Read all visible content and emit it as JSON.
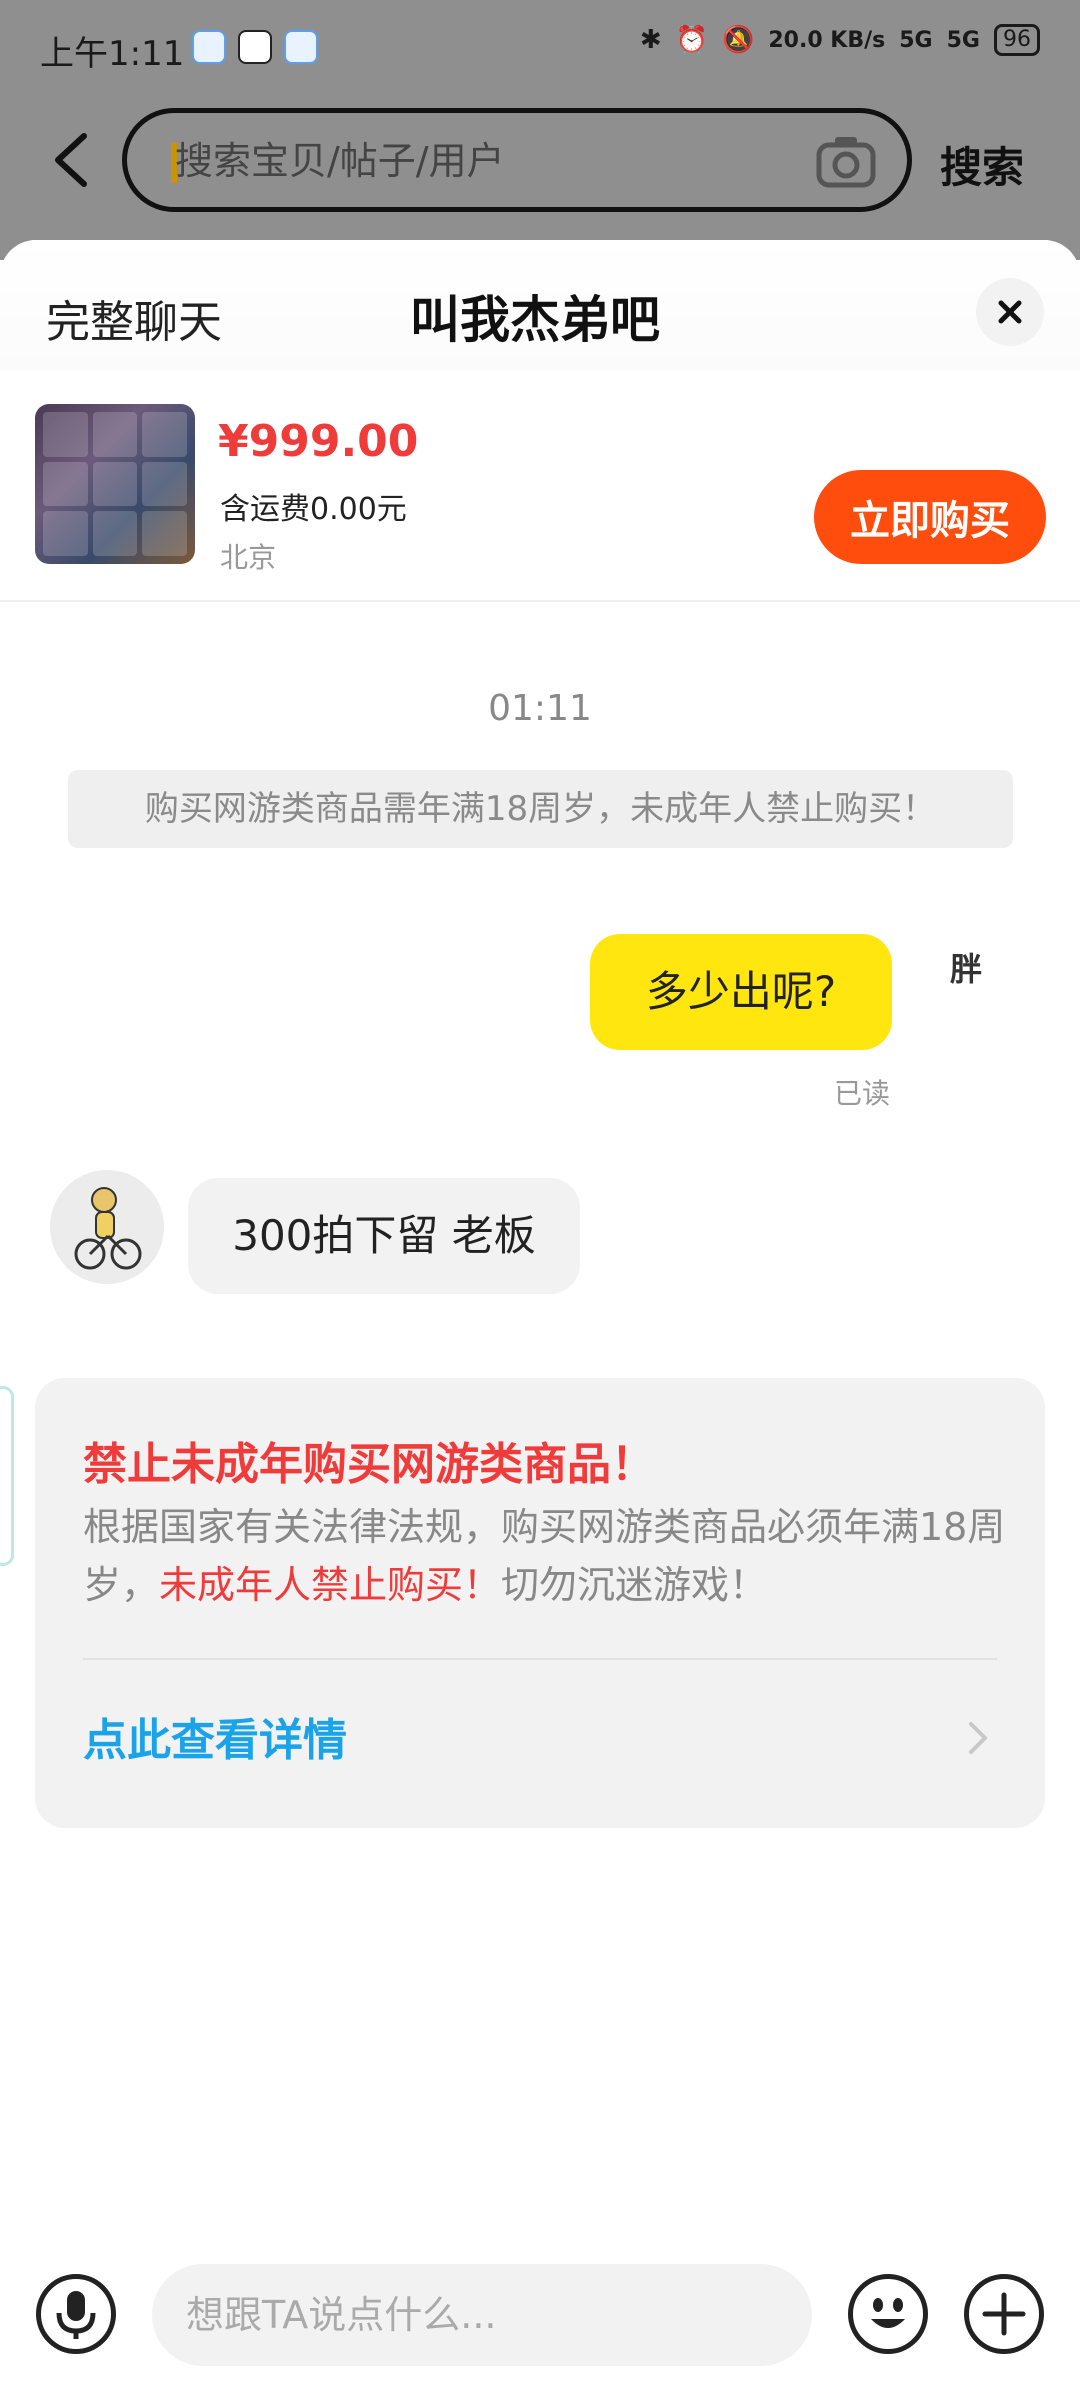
{
  "status_bar": {
    "time": "上午1:11",
    "net_speed": "20.0 KB/s",
    "net_type_1": "5G",
    "net_type_2": "5G",
    "battery": "96"
  },
  "search": {
    "placeholder": "搜索宝贝/帖子/用户",
    "search_label": "搜索"
  },
  "chat": {
    "full_chat_label": "完整聊天",
    "title": "叫我杰弟吧"
  },
  "product": {
    "price": "¥999.00",
    "shipping": "含运费0.00元",
    "location": "北京",
    "buy_label": "立即购买"
  },
  "messages": {
    "time": "01:11",
    "notice": "购买网游类商品需年满18周岁，未成年人禁止购买！",
    "outgoing_text": "多少出呢?",
    "self_avatar_text": "胖",
    "read_status": "已读",
    "incoming_text": "300拍下留 老板"
  },
  "warning_card": {
    "title": "禁止未成年购买网游类商品！",
    "body_part1": "根据国家有关法律法规，购买网游类商品必须年满18周岁，",
    "body_red": "未成年人禁止购买！",
    "body_part2": "切勿沉迷游戏！",
    "link": "点此查看详情"
  },
  "input": {
    "placeholder": "想跟TA说点什么..."
  },
  "colors": {
    "accent_orange": "#ff4d0e",
    "price_red": "#f03b3b",
    "bubble_yellow": "#ffe60f",
    "link_blue": "#1aa3e8"
  }
}
